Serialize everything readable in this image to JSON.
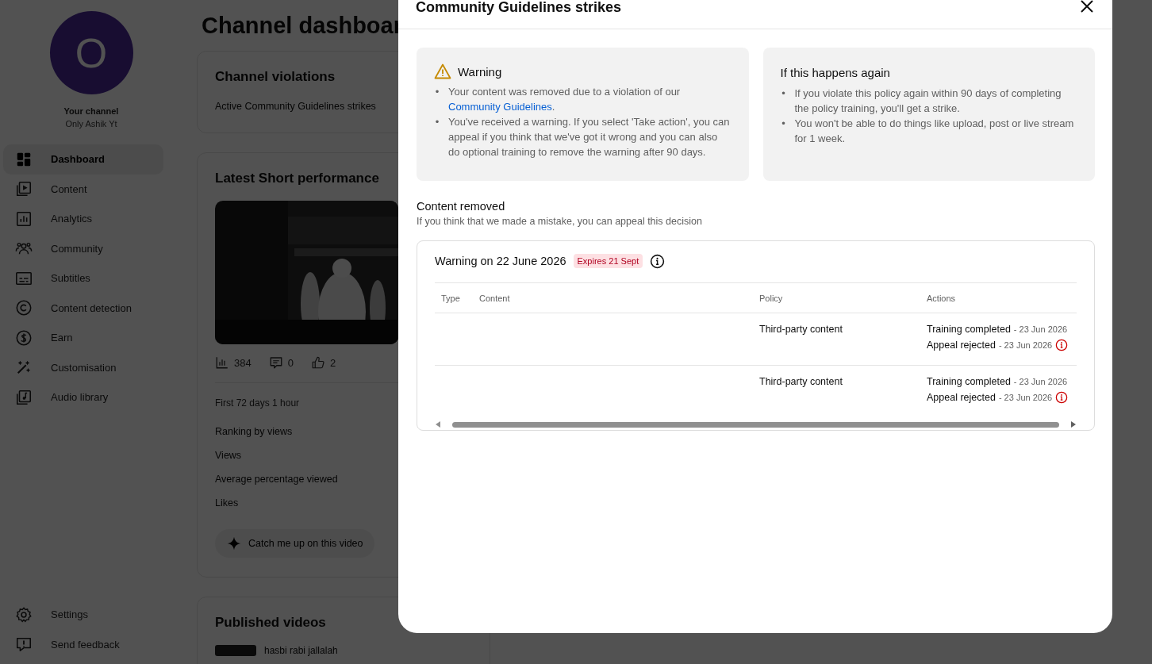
{
  "sidebar": {
    "avatar_letter": "O",
    "channel_label": "Your channel",
    "channel_name": "Only Ashik Yt",
    "items": [
      {
        "label": "Dashboard",
        "kind": "dashboard",
        "selected": true
      },
      {
        "label": "Content",
        "kind": "content",
        "selected": false
      },
      {
        "label": "Analytics",
        "kind": "analytics",
        "selected": false
      },
      {
        "label": "Community",
        "kind": "community",
        "selected": false
      },
      {
        "label": "Subtitles",
        "kind": "subtitles",
        "selected": false
      },
      {
        "label": "Content detection",
        "kind": "copyright",
        "selected": false
      },
      {
        "label": "Earn",
        "kind": "earn",
        "selected": false
      },
      {
        "label": "Customisation",
        "kind": "wand",
        "selected": false
      },
      {
        "label": "Audio library",
        "kind": "audio",
        "selected": false
      }
    ],
    "footer_items": [
      {
        "label": "Settings",
        "kind": "settings"
      },
      {
        "label": "Send feedback",
        "kind": "feedback"
      }
    ]
  },
  "main": {
    "title": "Channel dashboar",
    "violations": {
      "title": "Channel violations",
      "text": "Active Community Guidelines strikes"
    },
    "short": {
      "title": "Latest Short performance",
      "stats": [
        {
          "kind": "views",
          "value": "384"
        },
        {
          "kind": "comments",
          "value": "0"
        },
        {
          "kind": "likes",
          "value": "2"
        }
      ],
      "period": "First 72 days 1 hour",
      "metrics": [
        "Ranking by views",
        "Views",
        "Average percentage viewed",
        "Likes"
      ],
      "catch_button": "Catch me up on this video"
    },
    "published": {
      "title": "Published videos",
      "video_title": "hasbi rabi jallalah"
    }
  },
  "dialog": {
    "title": "Community Guidelines strikes",
    "warning": {
      "title": "Warning",
      "bullets": [
        {
          "marker": "•",
          "text": "Your content was removed due to a violation of our ",
          "link": "Community Guidelines",
          "after": "."
        },
        {
          "marker": "•",
          "text": "You've received a warning. If you select 'Take action', you can appeal if you think that we've got it wrong and you can also do optional training to remove the warning after 90 days."
        }
      ]
    },
    "again": {
      "title": "If this happens again",
      "bullets": [
        {
          "marker": "•",
          "text": "If you violate this policy again within 90 days of completing the policy training, you'll get a strike."
        },
        {
          "marker": "•",
          "text": "You won't be able to do things like upload, post or live stream for 1 week."
        }
      ]
    },
    "removed": {
      "title": "Content removed",
      "subtitle": "If you think that we made a mistake, you can appeal this decision"
    },
    "strike": {
      "title": "Warning on 22 June 2026",
      "badge": "Expires 21 Sept",
      "columns": [
        "Type",
        "Content",
        "Policy",
        "Actions"
      ],
      "rows": [
        {
          "policy": "Third-party content",
          "actions": [
            {
              "label": "Training completed",
              "date": "- 23 Jun 2026",
              "info": false
            },
            {
              "label": "Appeal rejected",
              "date": "- 23 Jun 2026",
              "info": true
            }
          ]
        },
        {
          "policy": "Third-party content",
          "actions": [
            {
              "label": "Training completed",
              "date": "- 23 Jun 2026",
              "info": false
            },
            {
              "label": "Appeal rejected",
              "date": "- 23 Jun 2026",
              "info": true
            }
          ]
        }
      ]
    }
  }
}
